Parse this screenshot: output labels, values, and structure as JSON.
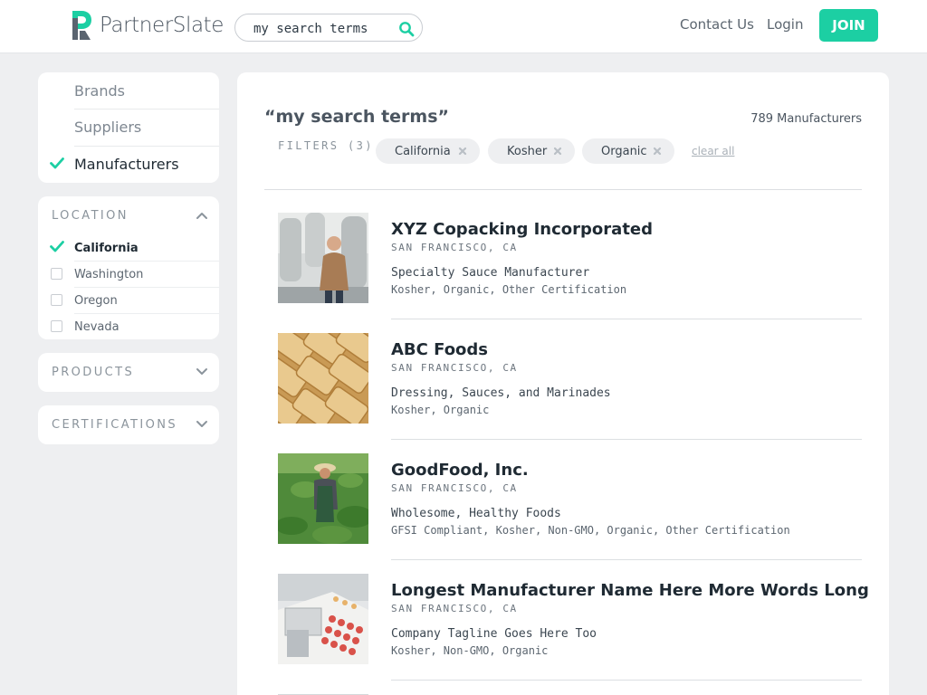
{
  "brand": {
    "name": "PartnerSlate",
    "accent": "#1ccfa3"
  },
  "search": {
    "value": "my search terms",
    "placeholder": ""
  },
  "nav": {
    "contact": "Contact Us",
    "login": "Login",
    "join": "JOIN"
  },
  "sidebar": {
    "types": [
      {
        "label": "Brands",
        "active": false
      },
      {
        "label": "Suppliers",
        "active": false
      },
      {
        "label": "Manufacturers",
        "active": true
      }
    ],
    "location": {
      "title": "LOCATION",
      "expanded": true,
      "items": [
        {
          "label": "California",
          "checked": true
        },
        {
          "label": "Washington",
          "checked": false
        },
        {
          "label": "Oregon",
          "checked": false
        },
        {
          "label": "Nevada",
          "checked": false
        }
      ]
    },
    "products": {
      "title": "PRODUCTS",
      "expanded": false
    },
    "certifications": {
      "title": "CERTIFICATIONS",
      "expanded": false
    }
  },
  "main": {
    "query_title": "“my search terms”",
    "result_count": "789 Manufacturers",
    "filters_label": "FILTERS (3)",
    "chips": [
      "California",
      "Kosher",
      "Organic"
    ],
    "clear_all": "clear all",
    "results": [
      {
        "name": "XYZ Copacking Incorporated",
        "location": "SAN FRANCISCO, CA",
        "tagline": "Specialty Sauce Manufacturer",
        "certs": "Kosher, Organic, Other Certification",
        "image": "man-in-factory"
      },
      {
        "name": "ABC Foods",
        "location": "SAN FRANCISCO, CA",
        "tagline": "Dressing, Sauces, and Marinades",
        "certs": "Kosher, Organic",
        "image": "crackers"
      },
      {
        "name": "GoodFood, Inc.",
        "location": "SAN FRANCISCO, CA",
        "tagline": "Wholesome, Healthy Foods",
        "certs": "GFSI Compliant, Kosher, Non-GMO, Organic, Other Certification",
        "image": "farmer-in-field"
      },
      {
        "name": "Longest Manufacturer Name Here More Words Long",
        "location": "SAN FRANCISCO, CA",
        "tagline": "Company Tagline Goes Here Too",
        "certs": "Kosher, Non-GMO, Organic",
        "image": "production-line"
      }
    ]
  }
}
